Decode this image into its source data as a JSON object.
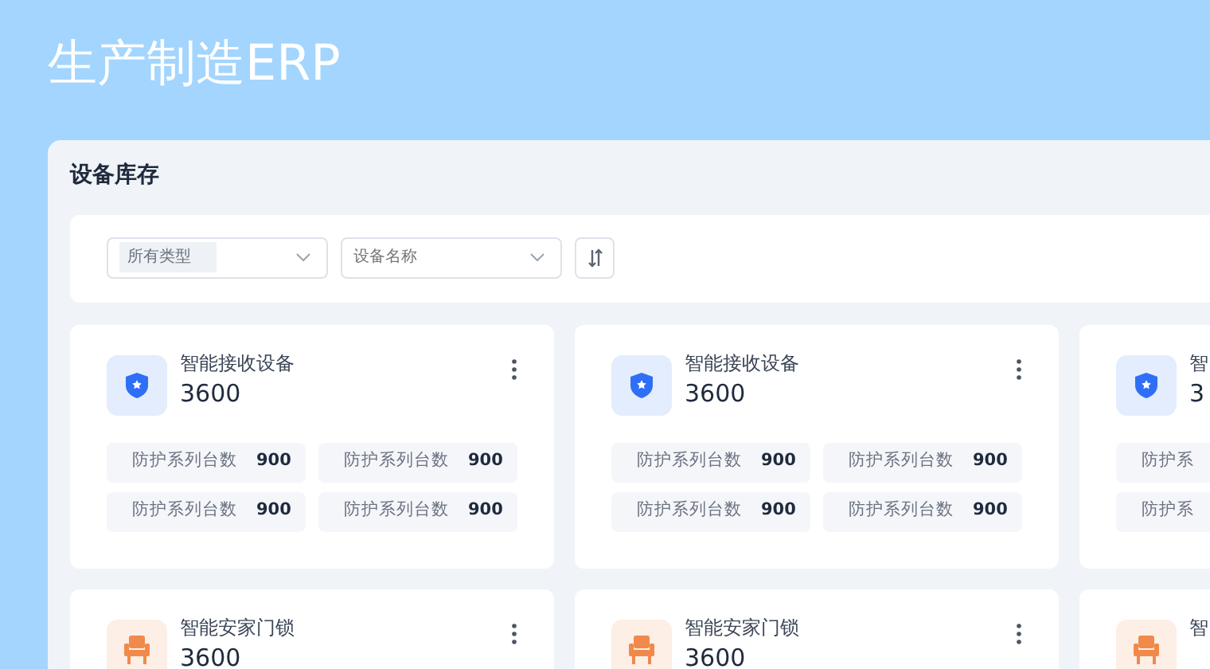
{
  "app_title": "生产制造ERP",
  "panel": {
    "title": "设备库存"
  },
  "filters": {
    "type_select": {
      "value": "所有类型"
    },
    "name_select": {
      "placeholder": "设备名称"
    }
  },
  "card_rows": [
    [
      {
        "kind": "shield",
        "title": "智能接收设备",
        "count": "3600",
        "stats": [
          {
            "label": "防护系列台数",
            "value": "900"
          },
          {
            "label": "防护系列台数",
            "value": "900"
          },
          {
            "label": "防护系列台数",
            "value": "900"
          },
          {
            "label": "防护系列台数",
            "value": "900"
          }
        ]
      },
      {
        "kind": "shield",
        "title": "智能接收设备",
        "count": "3600",
        "stats": [
          {
            "label": "防护系列台数",
            "value": "900"
          },
          {
            "label": "防护系列台数",
            "value": "900"
          },
          {
            "label": "防护系列台数",
            "value": "900"
          },
          {
            "label": "防护系列台数",
            "value": "900"
          }
        ]
      },
      {
        "kind": "shield",
        "title": "智",
        "count": "3",
        "stats": [
          {
            "label": "防护系"
          },
          {
            "label": "防护系"
          }
        ]
      }
    ],
    [
      {
        "kind": "chair",
        "title": "智能安家门锁",
        "count": "3600"
      },
      {
        "kind": "chair",
        "title": "智能安家门锁",
        "count": "3600"
      },
      {
        "kind": "chair",
        "title": "智"
      }
    ]
  ]
}
